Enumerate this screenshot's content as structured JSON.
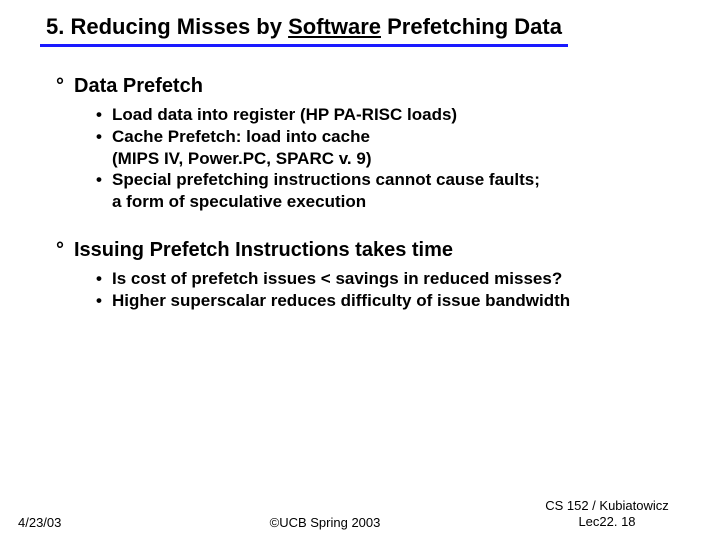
{
  "title": {
    "pre": "5. Reducing Misses by ",
    "underlined": "Software",
    "post": " Prefetching Data"
  },
  "sections": [
    {
      "heading": "Data Prefetch",
      "items": [
        "Load data into register (HP PA-RISC loads)",
        "Cache Prefetch: load into cache\n(MIPS IV, Power.PC, SPARC v. 9)",
        "Special prefetching instructions cannot cause faults;\na form of speculative execution"
      ]
    },
    {
      "heading": "Issuing Prefetch Instructions takes time",
      "items": [
        "Is cost of prefetch issues < savings in reduced misses?",
        "Higher superscalar reduces difficulty of issue bandwidth"
      ]
    }
  ],
  "footer": {
    "date": "4/23/03",
    "center": "©UCB Spring 2003",
    "right_line1": "CS 152 / Kubiatowicz",
    "right_line2": "Lec22. 18"
  },
  "symbols": {
    "degree": "°",
    "bullet": "•"
  }
}
